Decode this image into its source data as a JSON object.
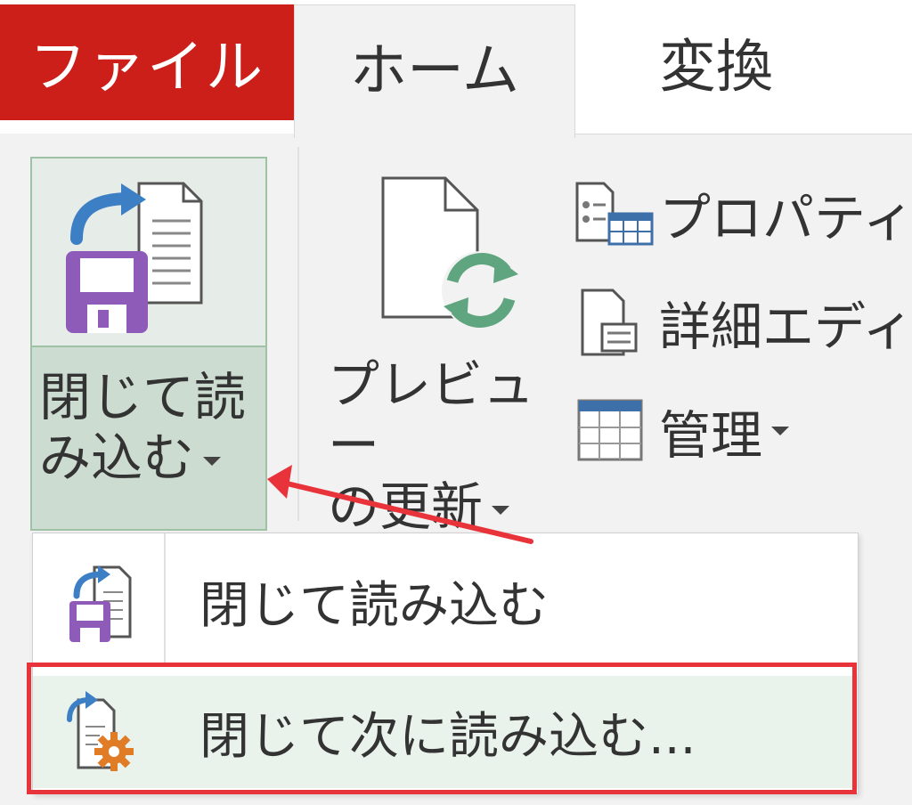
{
  "tabs": {
    "file": "ファイル",
    "home": "ホーム",
    "transform": "変換"
  },
  "ribbon": {
    "close_load": {
      "line1": "閉じて読",
      "line2": "み込む"
    },
    "refresh_preview": {
      "line1": "プレビュー",
      "line2": "の更新"
    },
    "properties": "プロパティ",
    "advanced_editor": "詳細エディ",
    "manage": "管理"
  },
  "dropdown": {
    "items": [
      {
        "label": "閉じて読み込む"
      },
      {
        "label": "閉じて次に読み込む..."
      }
    ]
  },
  "colors": {
    "file_tab": "#cc1f19",
    "annotation": "#e8333b",
    "save_purple": "#8f5bb8",
    "arrow_blue": "#3d7fc4",
    "refresh_green": "#5fa580",
    "gear_orange": "#e07b26"
  }
}
